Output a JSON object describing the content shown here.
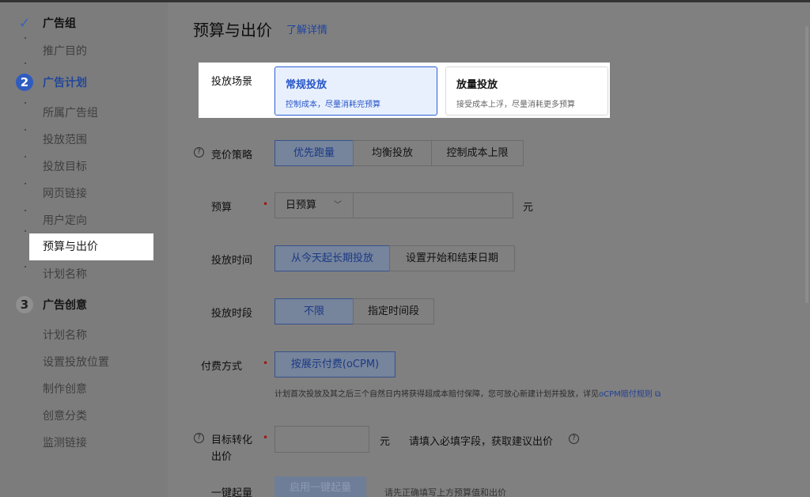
{
  "sidebar": {
    "steps": [
      {
        "badge": "✓",
        "title": "广告组"
      },
      {
        "badge": "2",
        "title": "广告计划"
      },
      {
        "badge": "3",
        "title": "广告创意"
      }
    ],
    "group_items": [
      "推广目的"
    ],
    "plan_items": [
      "所属广告组",
      "投放范围",
      "投放目标",
      "网页链接",
      "用户定向",
      "预算与出价",
      "计划名称"
    ],
    "creative_items": [
      "计划名称",
      "设置投放位置",
      "制作创意",
      "创意分类",
      "监测链接"
    ]
  },
  "main": {
    "title": "预算与出价",
    "learn_more": "了解详情",
    "scene": {
      "label": "投放场景",
      "options": [
        {
          "title": "常规投放",
          "desc": "控制成本，尽量消耗完预算"
        },
        {
          "title": "放量投放",
          "desc": "接受成本上浮，尽量消耗更多预算"
        }
      ]
    },
    "bid_strategy": {
      "label": "竞价策略",
      "options": [
        "优先跑量",
        "均衡投放",
        "控制成本上限"
      ]
    },
    "budget": {
      "label": "预算",
      "select": "日预算",
      "unit": "元"
    },
    "schedule": {
      "label": "投放时间",
      "options": [
        "从今天起长期投放",
        "设置开始和结束日期"
      ]
    },
    "time_period": {
      "label": "投放时段",
      "options": [
        "不限",
        "指定时间段"
      ]
    },
    "payment": {
      "label": "付费方式",
      "option": "按展示付费(oCPM)",
      "note": "计划首次投放及其之后三个自然日内将获得超成本赔付保障，您可放心新建计划并投放，详见",
      "note_link": "oCPM赔付规则"
    },
    "target_conv": {
      "label": "目标转化出价",
      "unit": "元",
      "hint": "请填入必填字段，获取建议出价"
    },
    "one_click": {
      "label": "一键起量",
      "button": "启用一键起量",
      "hint": "请先正确填写上方预算值和出价"
    }
  }
}
